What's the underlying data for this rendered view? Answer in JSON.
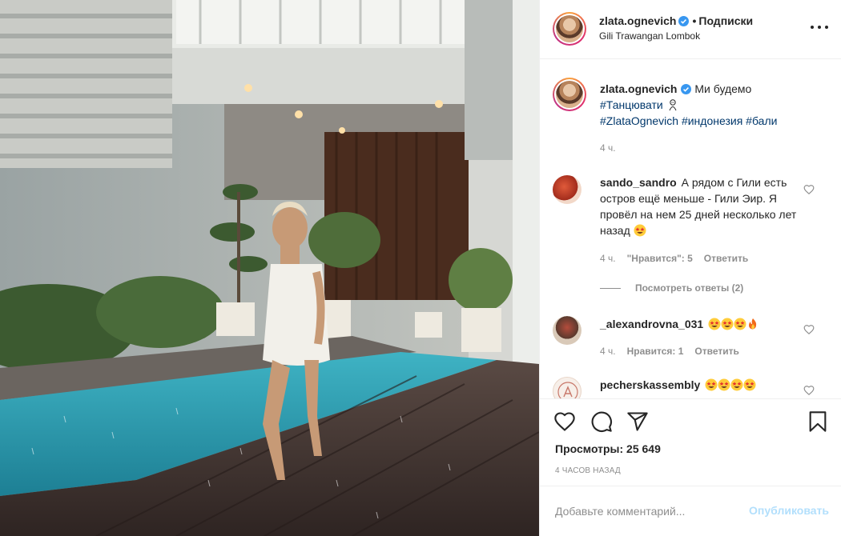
{
  "post": {
    "username": "zlata.ognevich",
    "follow_label": "Подписки",
    "location": "Gili Trawangan Lombok"
  },
  "caption": {
    "username": "zlata.ognevich",
    "text": "Ми будемо",
    "tag1": "#Танцювати",
    "tag2": "#ZlataOgnevich",
    "tag3": "#индонезия",
    "tag4": "#бали",
    "time": "4 ч."
  },
  "comments": [
    {
      "username": "sando_sandro",
      "text": "А рядом с Гили есть остров ещё меньше - Гили Эир. Я провёл на нем 25 дней несколько лет назад",
      "emojis": [
        "star-eyes-emoji"
      ],
      "time": "4 ч.",
      "likes": "\"Нравится\": 5",
      "reply": "Ответить",
      "view_replies": "Посмотреть ответы (2)"
    },
    {
      "username": "_alexandrovna_031",
      "text": "",
      "emojis": [
        "star-eyes-emoji",
        "star-eyes-emoji",
        "star-eyes-emoji",
        "fire-emoji"
      ],
      "time": "4 ч.",
      "likes": "Нравится: 1",
      "reply": "Ответить"
    },
    {
      "username": "pecherskassembly",
      "text": "",
      "emojis": [
        "star-eyes-emoji",
        "star-eyes-emoji",
        "star-eyes-emoji",
        "star-eyes-emoji"
      ]
    }
  ],
  "actions": {
    "views": "Просмотры: 25 649",
    "posted": "4 ЧАСОВ НАЗАД"
  },
  "add_comment": {
    "placeholder": "Добавьте комментарий...",
    "post_label": "Опубликовать"
  },
  "colors": {
    "link": "#00376b",
    "muted": "#8e8e8e",
    "post_disabled": "#b2dffc",
    "verified": "#3897f0"
  }
}
